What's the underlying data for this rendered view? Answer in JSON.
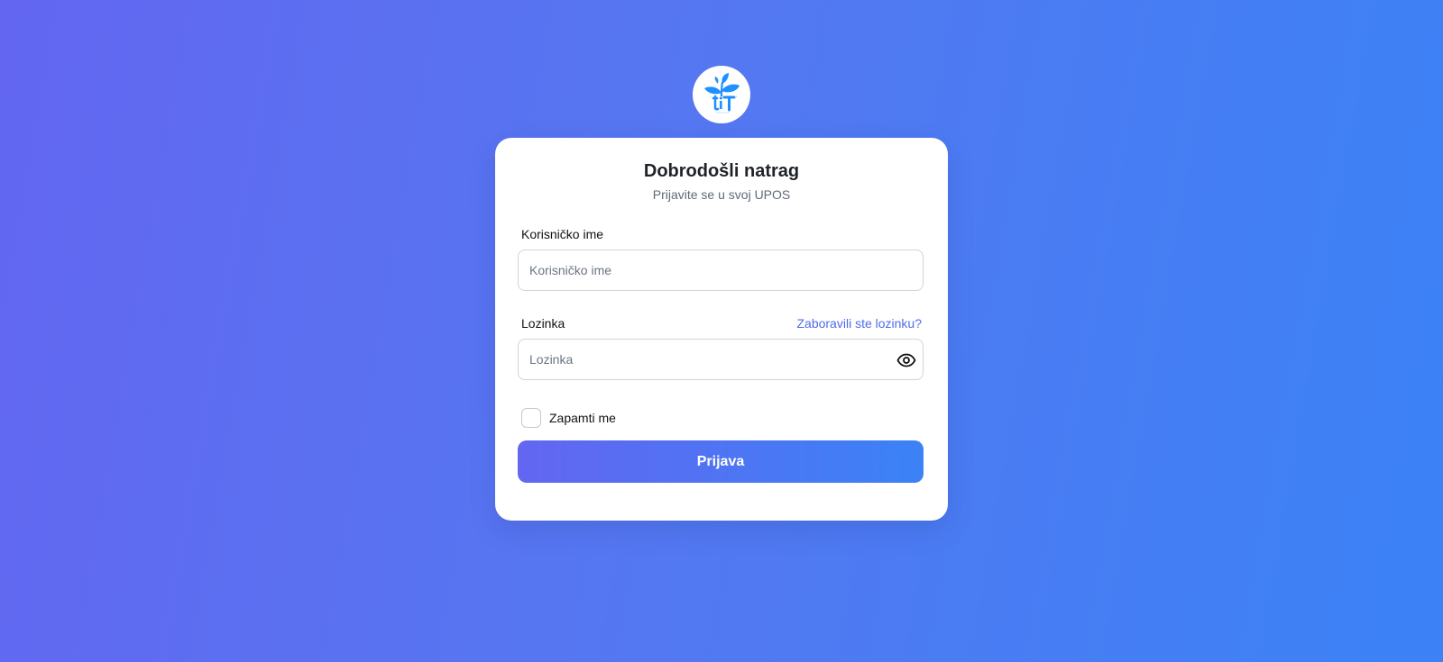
{
  "logo": {
    "icon": "plant-logo-icon",
    "text": "tiT"
  },
  "login": {
    "title": "Dobrodošli natrag",
    "subtitle": "Prijavite se u svoj UPOS",
    "username_label": "Korisničko ime",
    "username_placeholder": "Korisničko ime",
    "username_value": "",
    "password_label": "Lozinka",
    "password_placeholder": "Lozinka",
    "password_value": "",
    "forgot_link": "Zaboravili ste lozinku?",
    "show_password_icon": "eye-icon",
    "remember_label": "Zapamti me",
    "remember_checked": false,
    "submit_label": "Prijava"
  },
  "colors": {
    "gradient_start": "#6366f1",
    "gradient_end": "#3b82f6",
    "link": "#4f6bed",
    "logo_blue": "#1e90ff"
  }
}
